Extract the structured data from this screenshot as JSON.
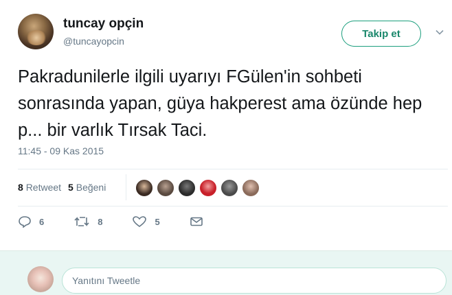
{
  "tweet": {
    "author_name": "tuncay opçin",
    "author_handle": "@tuncayopcin",
    "follow_label": "Takip et",
    "text": "Pakradunilerle ilgili uyarıyı FGülen'in sohbeti sonrasında yapan, güya hakperest ama özünde hep p... bir varlık Tırsak Taci.",
    "timestamp": "11:45 - 09 Kas 2015"
  },
  "stats": {
    "retweet_count": "8",
    "retweet_label": "Retweet",
    "like_count": "5",
    "like_label": "Beğeni"
  },
  "likers": [
    {
      "color": "#3a2a22"
    },
    {
      "color": "#5a4a40"
    },
    {
      "color": "#2b2b2b"
    },
    {
      "color": "#c8202a"
    },
    {
      "color": "#4a4a4a"
    },
    {
      "color": "#8a6a5a"
    }
  ],
  "actions": {
    "reply_count": "6",
    "retweet_count": "8",
    "like_count": "5"
  },
  "reply": {
    "placeholder": "Yanıtını Tweetle"
  },
  "colors": {
    "accent": "#1b9e7d",
    "muted": "#657786",
    "reply_bg": "#e9f6f3"
  }
}
